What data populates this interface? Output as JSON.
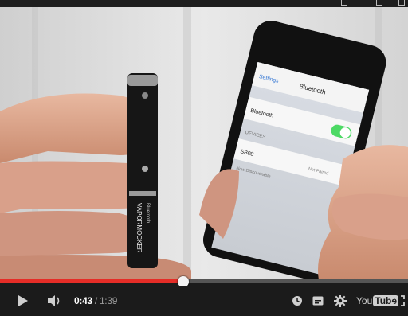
{
  "player": {
    "time_current": "0:43",
    "time_separator": " / ",
    "time_duration": "1:39",
    "progress_fraction": 0.45,
    "logo_you": "You",
    "logo_tube": "Tube"
  },
  "video_frame": {
    "phone_settings_back": "Settings",
    "phone_title": "Bluetooth",
    "phone_bluetooth_row": "Bluetooth",
    "phone_devices_header": "DEVICES",
    "phone_device_name": "SB08",
    "phone_device_status": "Not Paired",
    "phone_now_discoverable": "Now Discoverable",
    "pen_brand": "VAPORMOCKER",
    "pen_sub": "Bluetooth"
  },
  "icons": {
    "play": "play-icon",
    "volume": "volume-icon",
    "watch_later": "clock-icon",
    "captions": "captions-icon",
    "settings": "gear-icon",
    "fullscreen": "fullscreen-icon"
  },
  "colors": {
    "progress_played": "#e52d27",
    "progress_track": "#555555",
    "controls_bg": "#1b1b1b",
    "toggle_on": "#4cd964"
  }
}
